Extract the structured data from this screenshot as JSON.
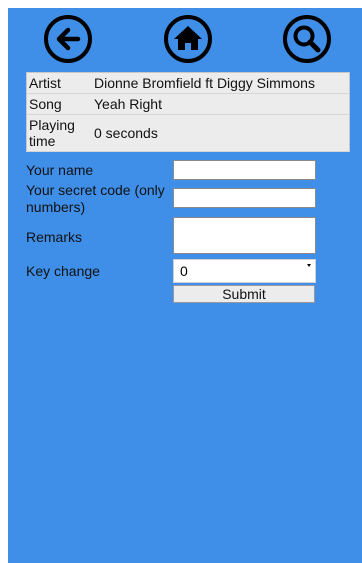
{
  "nav": {
    "back_icon": "arrow-left-icon",
    "home_icon": "home-icon",
    "search_icon": "search-icon"
  },
  "song_info": {
    "rows": [
      {
        "label": "Artist",
        "value": "Dionne Bromfield ft Diggy Simmons"
      },
      {
        "label": "Song",
        "value": "Yeah Right"
      },
      {
        "label": "Playing time",
        "value": "0 seconds"
      }
    ]
  },
  "form": {
    "name_label": "Your name",
    "name_value": "",
    "code_label": "Your secret code (only numbers)",
    "code_value": "",
    "remarks_label": "Remarks",
    "remarks_value": "",
    "key_label": "Key change",
    "key_value": "0",
    "submit_label": "Submit"
  },
  "colors": {
    "background": "#3f8fe8",
    "table_background": "#ececec"
  }
}
